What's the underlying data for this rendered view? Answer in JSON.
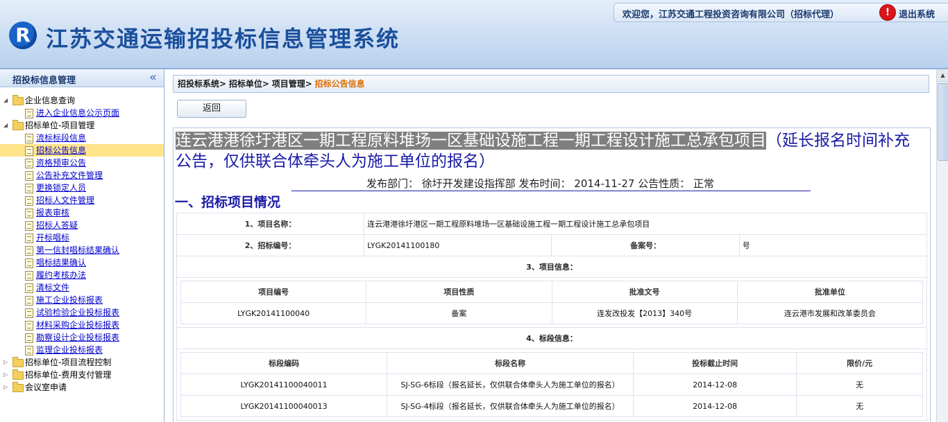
{
  "header": {
    "logo_text": "R",
    "title": "江苏交通运输招投标信息管理系统",
    "welcome": "欢迎您，江苏交通工程投资咨询有限公司（招标代理）",
    "logout_icon": "!",
    "logout": "退出系统"
  },
  "sidebar": {
    "title": "招投标信息管理",
    "collapse_icon": "«",
    "tree": [
      {
        "type": "folder",
        "label": "企业信息查询",
        "expanded": true
      },
      {
        "type": "leaf",
        "label": "进入企业信息公示页面"
      },
      {
        "type": "folder",
        "label": "招标单位-项目管理",
        "expanded": true
      },
      {
        "type": "leaf",
        "label": "流标标段信息"
      },
      {
        "type": "leaf",
        "label": "招标公告信息",
        "selected": true
      },
      {
        "type": "leaf",
        "label": "资格预审公告"
      },
      {
        "type": "leaf",
        "label": "公告补充文件管理"
      },
      {
        "type": "leaf",
        "label": "更换锁定人员"
      },
      {
        "type": "leaf",
        "label": "招标人文件管理"
      },
      {
        "type": "leaf",
        "label": "报表审核"
      },
      {
        "type": "leaf",
        "label": "招标人答疑"
      },
      {
        "type": "leaf",
        "label": "开标唱标"
      },
      {
        "type": "leaf",
        "label": "第一信封唱标结果确认"
      },
      {
        "type": "leaf",
        "label": "唱标结果确认"
      },
      {
        "type": "leaf",
        "label": "履约考核办法"
      },
      {
        "type": "leaf",
        "label": "清标文件"
      },
      {
        "type": "leaf",
        "label": "施工企业投标报表"
      },
      {
        "type": "leaf",
        "label": "试验检验企业投标报表"
      },
      {
        "type": "leaf",
        "label": "材料采购企业投标报表"
      },
      {
        "type": "leaf",
        "label": "勘察设计企业投标报表"
      },
      {
        "type": "leaf",
        "label": "监理企业投标报表"
      },
      {
        "type": "folder",
        "label": "招标单位-项目流程控制",
        "expanded": false
      },
      {
        "type": "folder",
        "label": "招标单位-费用支付管理",
        "expanded": false
      },
      {
        "type": "folder",
        "label": "会议室申请",
        "expanded": false
      }
    ]
  },
  "breadcrumb": {
    "items": [
      "招投标系统>",
      "招标单位>",
      "项目管理>"
    ],
    "current": "招标公告信息"
  },
  "back_button": "返回",
  "notice": {
    "title_highlighted": "连云港港徐圩港区一期工程原料堆场一区基础设施工程一期工程设计施工总承包项目",
    "title_rest": "（延长报名时间补充公告，仅供联合体牵头人为施工单位的报名）",
    "publish_info": "发布部门： 徐圩开发建设指挥部 发布时间： 2014-11-27 公告性质： 正常",
    "section_heading": "一、招标项目情况"
  },
  "project": {
    "name_label": "1、项目名称：",
    "name_value": "连云港港徐圩港区一期工程原料堆场一区基础设施工程一期工程设计施工总承包项目",
    "code_label": "2、招标编号：",
    "code_value": "LYGK20141100180",
    "record_label": "备案号：",
    "record_value": "号",
    "info_label": "3、项目信息：",
    "info_headers": [
      "项目编号",
      "项目性质",
      "批准文号",
      "批准单位"
    ],
    "info_row": [
      "LYGK20141100040",
      "备案",
      "连发改投发【2013】340号",
      "连云港市发展和改革委员会"
    ],
    "section_label": "4、标段信息：",
    "section_headers": [
      "标段编码",
      "标段名称",
      "投标截止时间",
      "限价/元"
    ],
    "section_rows": [
      [
        "LYGK20141100040011",
        "SJ-SG-6标段（报名延长，仅供联合体牵头人为施工单位的报名）",
        "2014-12-08",
        "无"
      ],
      [
        "LYGK20141100040013",
        "SJ-SG-4标段（报名延长，仅供联合体牵头人为施工单位的报名）",
        "2014-12-08",
        "无"
      ]
    ]
  },
  "scrollbar": {
    "up_arrow": "▲"
  },
  "colors": {
    "header_title": "#1a4f9c",
    "link": "#0000cc",
    "selected_bg": "#ffe48a",
    "notice_title": "#1a1aa8",
    "breadcrumb_current": "#e06c00"
  }
}
